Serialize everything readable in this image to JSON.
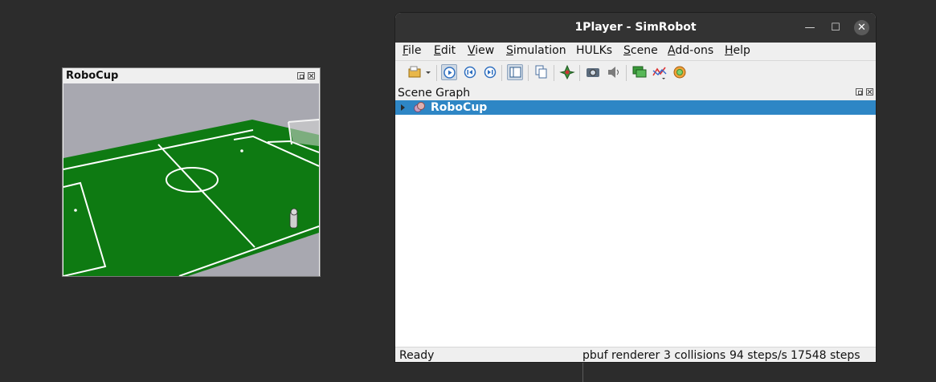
{
  "floating_view": {
    "title": "RoboCup"
  },
  "window": {
    "title": "1Player - SimRobot",
    "controls": {
      "minimize": "—",
      "maximize": "☐",
      "close": "✕"
    }
  },
  "menu": [
    "File",
    "Edit",
    "View",
    "Simulation",
    "HULKs",
    "Scene",
    "Add-ons",
    "Help"
  ],
  "toolbar": {
    "buttons": [
      "open-icon",
      "play-icon",
      "reset-icon",
      "step-icon",
      "scene-graph-toggle-icon",
      "copy-icon",
      "move-object-icon",
      "camera-icon",
      "sound-icon",
      "chat-icon",
      "graph-icon",
      "render-icon"
    ]
  },
  "scene_graph": {
    "title": "Scene Graph",
    "items": [
      {
        "label": "RoboCup",
        "selected": true
      }
    ]
  },
  "status": {
    "left": "Ready",
    "renderer": "pbuf renderer",
    "collisions": "3 collisions",
    "rate": "94 steps/s",
    "steps": "17548 steps"
  },
  "colors": {
    "selection": "#2e86c5",
    "field": "#0e7a12",
    "titlebar": "#333333"
  }
}
